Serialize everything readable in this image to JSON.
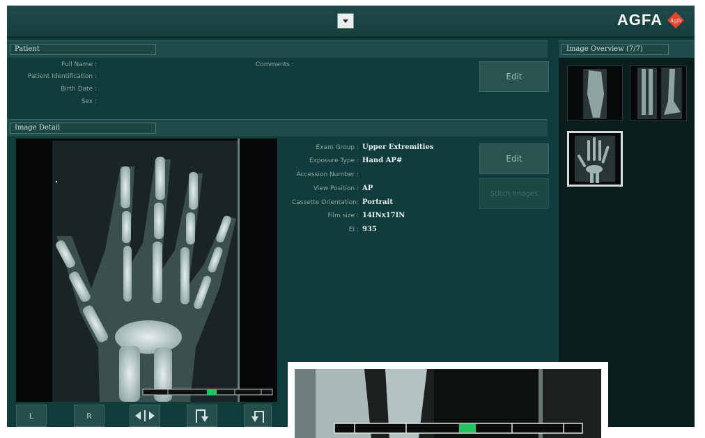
{
  "brand": {
    "name": "AGFA",
    "logo_text": "Agfa"
  },
  "patient": {
    "header": "Patient",
    "fields": [
      {
        "label": "Full Name :",
        "value": ""
      },
      {
        "label": "Patient Identification :",
        "value": ""
      },
      {
        "label": "Birth Date :",
        "value": ""
      },
      {
        "label": "Sex :",
        "value": ""
      }
    ],
    "comments_label": "Comments :",
    "edit_label": "Edit"
  },
  "image_detail": {
    "header": "Image Detail",
    "fields": [
      {
        "label": "Exam Group :",
        "value": "Upper Extremities"
      },
      {
        "label": "Exposure Type :",
        "value": "Hand AP#"
      },
      {
        "label": "Accession Number :",
        "value": ""
      },
      {
        "label": "View Position :",
        "value": "AP"
      },
      {
        "label": "Cassette Orientation:",
        "value": "Portrait"
      },
      {
        "label": "Film size :",
        "value": "14INx17IN"
      },
      {
        "label": "EI :",
        "value": "935"
      }
    ],
    "edit_label": "Edit",
    "stitch_label": "Stitch Images"
  },
  "overview": {
    "header": "Image Overview (7/7)"
  },
  "toolbar": {
    "left_label": "L",
    "right_label": "R"
  },
  "colors": {
    "accent_green": "#22c55e",
    "panel_bg": "#103c3b"
  }
}
